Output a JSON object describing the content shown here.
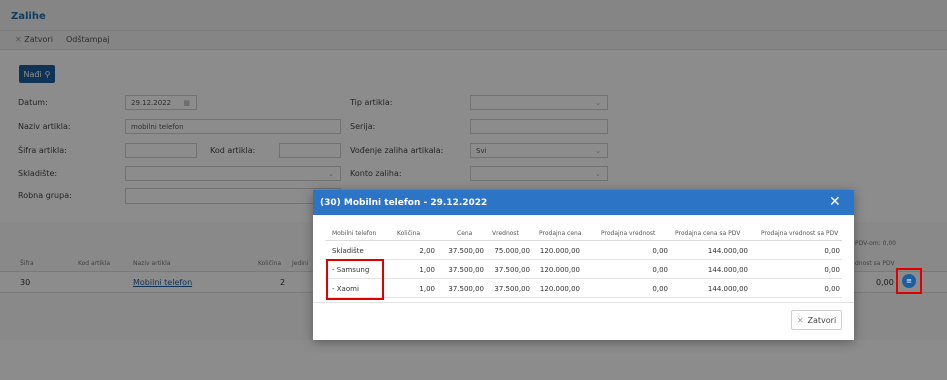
{
  "window": {
    "title": "Zalihe"
  },
  "toolbar": {
    "close_label": "Zatvori",
    "print_label": "Odštampaj"
  },
  "search": {
    "find_label": "Nađi"
  },
  "form": {
    "datum_label": "Datum:",
    "datum_value": "29.12.2022",
    "naziv_label": "Naziv artikla:",
    "naziv_value": "mobilni telefon",
    "sifra_label": "Šifra artikla:",
    "kod_label": "Kod artikla:",
    "skladiste_label": "Skladište:",
    "robna_label": "Robna grupa:",
    "tip_label": "Tip artikla:",
    "serija_label": "Serija:",
    "vodjenje_label": "Vođenje zaliha artikala:",
    "vodjenje_value": "Svi",
    "konto_label": "Konto zaliha:"
  },
  "table": {
    "headers": [
      "Šifra",
      "Kod artikla",
      "Naziv artikla",
      "Količina",
      "Jedini"
    ],
    "right_header_top": "PDV-om: 0,00",
    "right_header": "dnost sa PDV",
    "row": {
      "sifra": "30",
      "naziv": "Mobilni telefon",
      "kolicina": "2",
      "value": "0,00"
    }
  },
  "modal": {
    "title": "(30) Mobilni telefon - 29.12.2022",
    "columns": [
      "Mobilni telefon",
      "Količina",
      "Cena",
      "Vrednost",
      "Prodajna cena",
      "Prodajna vrednost",
      "Prodajna cena sa PDV",
      "Prodajna vrednost sa PDV"
    ],
    "rows": [
      {
        "name": "Skladište",
        "kolicina": "2,00",
        "cena": "37.500,00",
        "vrednost": "75.000,00",
        "pcena": "120.000,00",
        "pvrednost": "0,00",
        "pcenapdv": "144.000,00",
        "pvrednostpdv": "0,00"
      },
      {
        "name": "- Samsung",
        "kolicina": "1,00",
        "cena": "37.500,00",
        "vrednost": "37.500,00",
        "pcena": "120.000,00",
        "pvrednost": "0,00",
        "pcenapdv": "144.000,00",
        "pvrednostpdv": "0,00"
      },
      {
        "name": "- Xaomi",
        "kolicina": "1,00",
        "cena": "37.500,00",
        "vrednost": "37.500,00",
        "pcena": "120.000,00",
        "pvrednost": "0,00",
        "pcenapdv": "144.000,00",
        "pvrednostpdv": "0,00"
      }
    ],
    "close_label": "Zatvori"
  },
  "colors": {
    "accent": "#2c74c6",
    "button": "#1d5e9f",
    "highlight": "#e00000"
  },
  "icons": {
    "close": "close-icon",
    "search": "search-icon",
    "calendar": "calendar-icon",
    "view": "view-icon"
  }
}
